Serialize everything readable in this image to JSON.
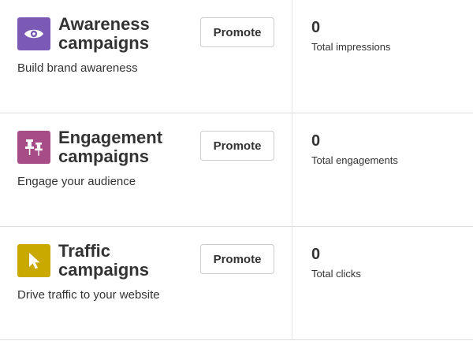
{
  "campaigns": [
    {
      "icon": "eye-icon",
      "icon_color": "#7b5ab6",
      "title_line1": "Awareness",
      "title_line2": "campaigns",
      "description": "Build brand awareness",
      "button_label": "Promote",
      "stat_value": "0",
      "stat_label": "Total impressions"
    },
    {
      "icon": "pushpin-icon",
      "icon_color": "#a64d88",
      "title_line1": "Engagement",
      "title_line2": "campaigns",
      "description": "Engage your audience",
      "button_label": "Promote",
      "stat_value": "0",
      "stat_label": "Total engagements"
    },
    {
      "icon": "cursor-icon",
      "icon_color": "#c9a800",
      "title_line1": "Traffic",
      "title_line2": "campaigns",
      "description": "Drive traffic to your website",
      "button_label": "Promote",
      "stat_value": "0",
      "stat_label": "Total clicks"
    }
  ]
}
